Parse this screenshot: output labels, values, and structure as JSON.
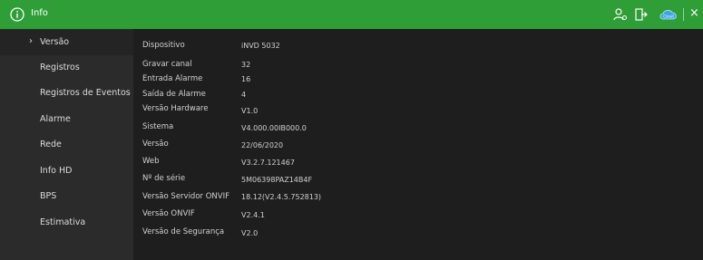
{
  "header": {
    "title": "Info",
    "accent": "#2f9e37",
    "icons": [
      "info-icon",
      "user-icon",
      "logout-icon",
      "cloud-icon",
      "close-icon"
    ],
    "cloud_label": "Cloud",
    "close_glyph": "×"
  },
  "sidebar": {
    "items": [
      {
        "label": "Versão",
        "active": true
      },
      {
        "label": "Registros"
      },
      {
        "label": "Registros de Eventos"
      },
      {
        "label": "Alarme"
      },
      {
        "label": "Rede"
      },
      {
        "label": "Info HD"
      },
      {
        "label": "BPS"
      },
      {
        "label": "Estimativa"
      }
    ]
  },
  "version": {
    "rows": [
      {
        "label": "Dispositivo",
        "value": "iNVD 5032"
      },
      {
        "label": "Gravar canal",
        "value": "32"
      },
      {
        "label": "Entrada Alarme",
        "value": "16"
      },
      {
        "label": "Saída de Alarme",
        "value": "4"
      },
      {
        "label": "Versão Hardware",
        "value": "V1.0"
      },
      {
        "label": "Sistema",
        "value": "V4.000.00IB000.0"
      },
      {
        "label": "Versão",
        "value": "22/06/2020"
      },
      {
        "label": "Web",
        "value": "V3.2.7.121467"
      },
      {
        "label": "Nº de série",
        "value": "5M06398PAZ14B4F"
      },
      {
        "label": "Versão Servidor ONVIF",
        "value": "18.12(V2.4.5.752813)"
      },
      {
        "label": "Versão ONVIF",
        "value": "V2.4.1"
      },
      {
        "label": "Versão de Segurança",
        "value": "V2.0"
      }
    ]
  }
}
